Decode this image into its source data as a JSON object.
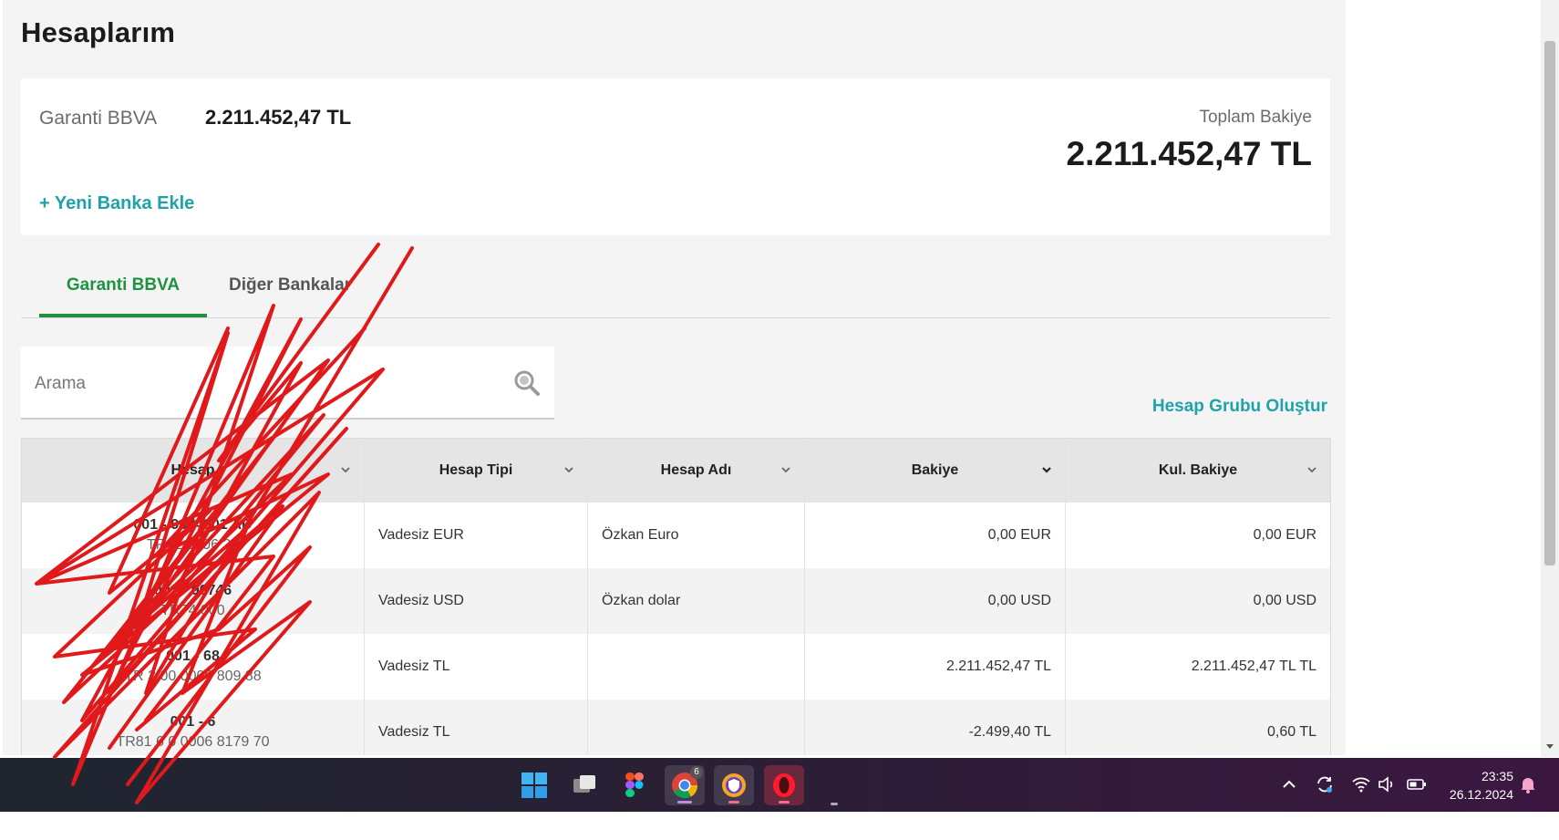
{
  "page": {
    "title": "Hesaplarım"
  },
  "summary": {
    "bank_name": "Garanti BBVA",
    "bank_amount": "2.211.452,47 TL",
    "add_bank_label": "+ Yeni Banka Ekle",
    "total_label": "Toplam Bakiye",
    "total_amount": "2.211.452,47 TL"
  },
  "tabs": [
    {
      "label": "Garanti BBVA",
      "active": true
    },
    {
      "label": "Diğer Bankalar",
      "active": false
    }
  ],
  "search": {
    "placeholder": "Arama",
    "value": ""
  },
  "group_link_label": "Hesap Grubu Oluştur",
  "table": {
    "columns": [
      "Hesap",
      "Hesap Tipi",
      "Hesap Adı",
      "Bakiye",
      "Kul. Bakiye"
    ],
    "rows": [
      {
        "account_no": "001 - 9074601 AD",
        "iban": "TR42 0006 20",
        "type": "Vadesiz EUR",
        "name": "Özkan Euro",
        "balance": "0,00 EUR",
        "usable": "0,00 EUR"
      },
      {
        "account_no": "001 - 90746",
        "iban": "TR74 000",
        "type": "Vadesiz USD",
        "name": "Özkan dolar",
        "balance": "0,00 USD",
        "usable": "0,00 USD"
      },
      {
        "account_no": "001 - 68",
        "iban": "TR 3 00 0006 809 88",
        "type": "Vadesiz TL",
        "name": "",
        "balance": "2.211.452,47 TL",
        "usable": "2.211.452,47 TL TL"
      },
      {
        "account_no": "001 - 6",
        "iban": "TR81 6 0 0006 8179 70",
        "type": "Vadesiz TL",
        "name": "",
        "balance": "-2.499,40 TL",
        "usable": "0,60 TL"
      }
    ]
  },
  "taskbar": {
    "time": "23:35",
    "date": "26.12.2024",
    "chrome_badge": "6",
    "colors": {
      "accent_green": "#1e9240",
      "link_teal": "#1fa3a8"
    },
    "icons": [
      "windows-start-icon",
      "task-view-icon",
      "figma-icon",
      "chrome-icon",
      "vpn-shield-icon",
      "opera-icon"
    ]
  }
}
